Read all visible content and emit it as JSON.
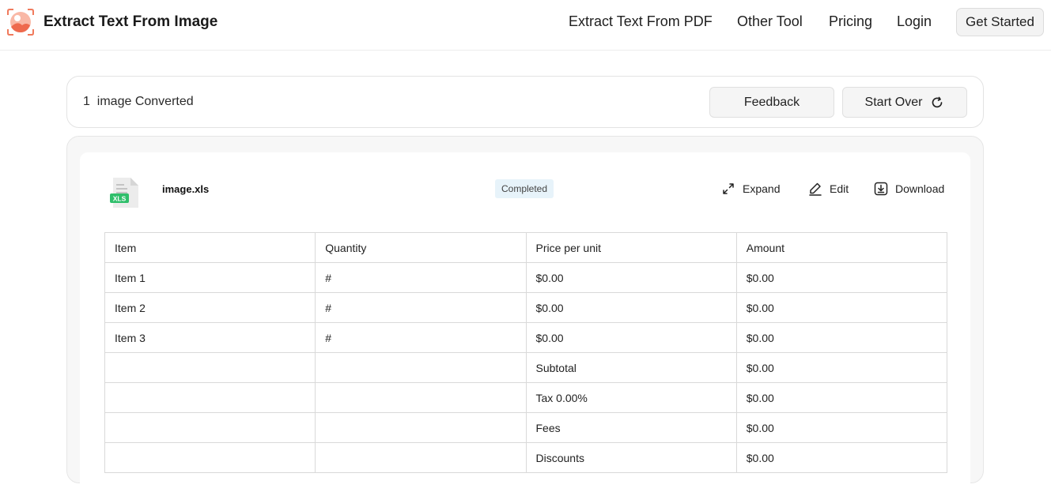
{
  "header": {
    "brand": "Extract Text From Image",
    "nav": [
      "Extract Text From PDF",
      "Other Tool",
      "Pricing",
      "Login"
    ],
    "cta": "Get Started"
  },
  "status": {
    "count": "1",
    "text": "image Converted",
    "feedback_label": "Feedback",
    "start_over_label": "Start Over"
  },
  "result": {
    "file_type": "XLS",
    "file_name": "image.xls",
    "badge": "Completed",
    "actions": {
      "expand": "Expand",
      "edit": "Edit",
      "download": "Download"
    }
  },
  "table": {
    "rows": [
      [
        "Item",
        "Quantity",
        "Price per unit",
        "Amount"
      ],
      [
        "Item 1",
        "#",
        "$0.00",
        "$0.00"
      ],
      [
        "Item 2",
        "#",
        "$0.00",
        "$0.00"
      ],
      [
        "Item 3",
        "#",
        "$0.00",
        "$0.00"
      ],
      [
        "",
        "",
        "Subtotal",
        "$0.00"
      ],
      [
        "",
        "",
        "Tax 0.00%",
        "$0.00"
      ],
      [
        "",
        "",
        "Fees",
        "$0.00"
      ],
      [
        "",
        "",
        "Discounts",
        "$0.00"
      ]
    ]
  },
  "colors": {
    "accent": "#f07a5c",
    "badge_bg": "#e7f3fa",
    "xls_green": "#2fbf6b"
  }
}
